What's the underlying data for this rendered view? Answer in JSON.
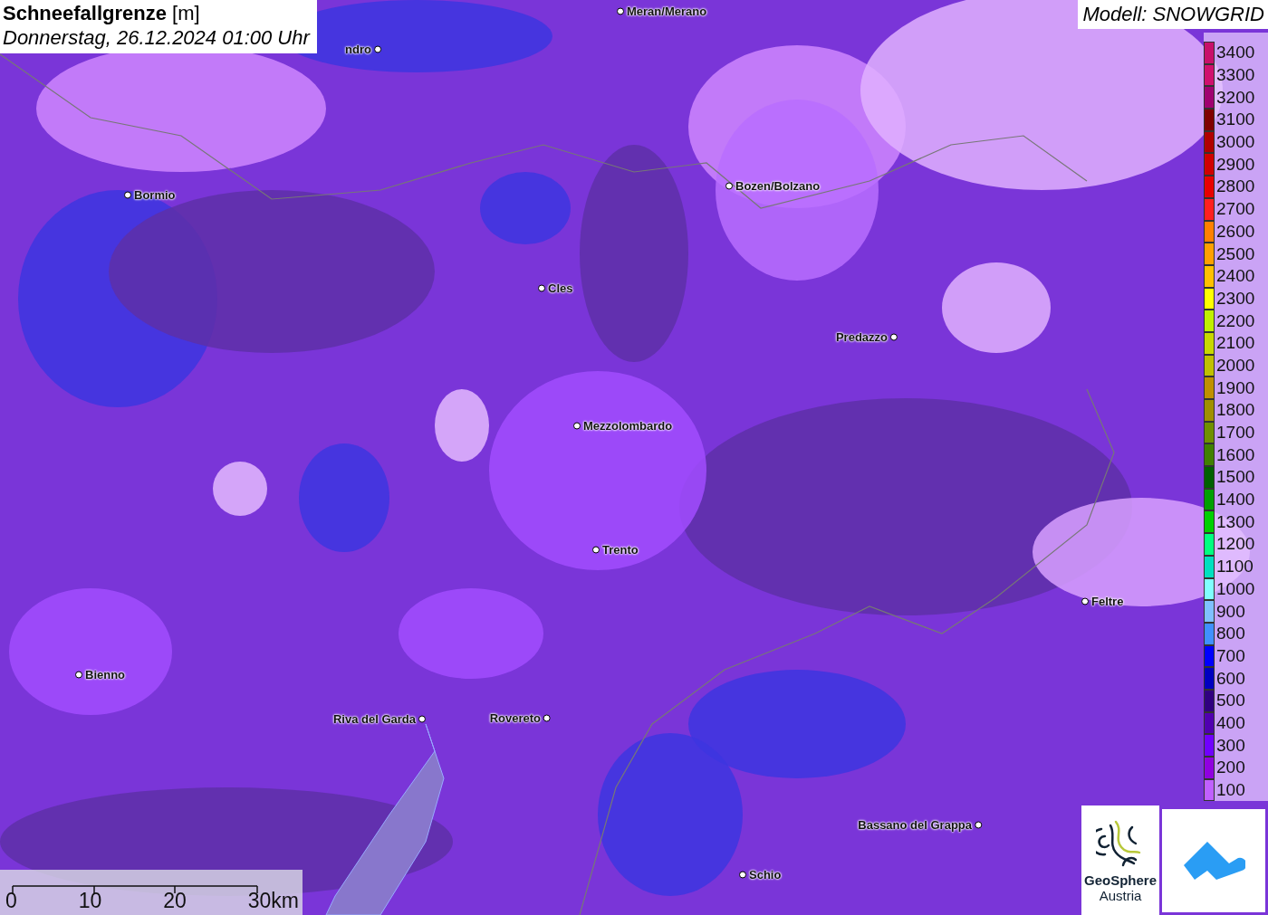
{
  "title": {
    "name": "Schneefallgrenze",
    "unit": "[m]",
    "time": "Donnerstag, 26.12.2024 01:00 Uhr"
  },
  "model": "Modell: SNOWGRID",
  "places": [
    {
      "name": "Meran/Merano"
    },
    {
      "name": "ndro"
    },
    {
      "name": "Bormio"
    },
    {
      "name": "Bozen/Bolzano"
    },
    {
      "name": "Cles"
    },
    {
      "name": "Predazzo"
    },
    {
      "name": "Mezzolombardo"
    },
    {
      "name": "Trento"
    },
    {
      "name": "Feltre"
    },
    {
      "name": "Bienno"
    },
    {
      "name": "Riva del Garda"
    },
    {
      "name": "Rovereto"
    },
    {
      "name": "Bassano del Grappa"
    },
    {
      "name": "Schio"
    }
  ],
  "legend": [
    {
      "label": "3400",
      "color": "#c8106a"
    },
    {
      "label": "3300",
      "color": "#d0106e"
    },
    {
      "label": "3200",
      "color": "#a00070"
    },
    {
      "label": "3100",
      "color": "#800000"
    },
    {
      "label": "3000",
      "color": "#b00000"
    },
    {
      "label": "2900",
      "color": "#d00000"
    },
    {
      "label": "2800",
      "color": "#e80000"
    },
    {
      "label": "2700",
      "color": "#ff2020"
    },
    {
      "label": "2600",
      "color": "#ff8000"
    },
    {
      "label": "2500",
      "color": "#ffa000"
    },
    {
      "label": "2400",
      "color": "#ffc000"
    },
    {
      "label": "2300",
      "color": "#ffff00"
    },
    {
      "label": "2200",
      "color": "#c0f000"
    },
    {
      "label": "2100",
      "color": "#c8d800"
    },
    {
      "label": "2000",
      "color": "#c0c000"
    },
    {
      "label": "1900",
      "color": "#c09000"
    },
    {
      "label": "1800",
      "color": "#a09000"
    },
    {
      "label": "1700",
      "color": "#709000"
    },
    {
      "label": "1600",
      "color": "#408000"
    },
    {
      "label": "1500",
      "color": "#006000"
    },
    {
      "label": "1400",
      "color": "#00a000"
    },
    {
      "label": "1300",
      "color": "#00d000"
    },
    {
      "label": "1200",
      "color": "#00ff80"
    },
    {
      "label": "1100",
      "color": "#00e0c0"
    },
    {
      "label": "1000",
      "color": "#80ffff"
    },
    {
      "label": "900",
      "color": "#80c0ff"
    },
    {
      "label": "800",
      "color": "#4090ff"
    },
    {
      "label": "700",
      "color": "#0000ff"
    },
    {
      "label": "600",
      "color": "#0000c0"
    },
    {
      "label": "500",
      "color": "#300080"
    },
    {
      "label": "400",
      "color": "#5000b0"
    },
    {
      "label": "300",
      "color": "#7000ff"
    },
    {
      "label": "200",
      "color": "#9000e0"
    },
    {
      "label": "100",
      "color": "#c060ff"
    }
  ],
  "scale": [
    "0",
    "10",
    "20",
    "30km"
  ],
  "logo": {
    "line1": "GeoSphere",
    "line2": "Austria"
  }
}
